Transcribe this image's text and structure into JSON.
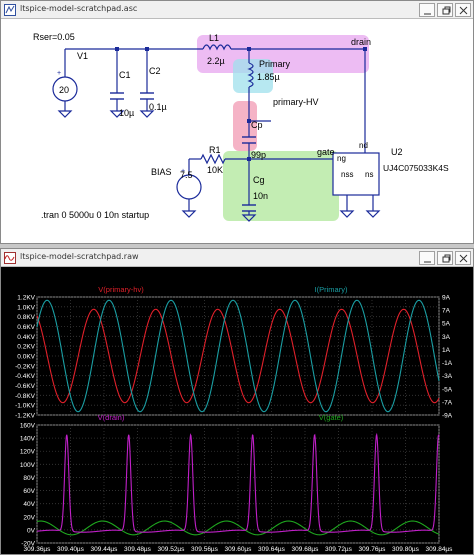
{
  "schematic_window": {
    "title": "ltspice-model-scratchpad.asc",
    "buttons": [
      "minimize",
      "restore",
      "close"
    ],
    "labels": {
      "rser": "Rser=0.05",
      "v1_name": "V1",
      "v1_value": "20",
      "c1_name": "C1",
      "c1_value": "10µ",
      "c2_name": "C2",
      "c2_value": "0.1µ",
      "l1_name": "L1",
      "l1_value": "2.2µ",
      "drain_net": "drain",
      "primary_name": "Primary",
      "primary_value": "1.85µ",
      "primary_hv_net": "primary-HV",
      "cp_name": "Cp",
      "cp_value": "99p",
      "r1_name": "R1",
      "r1_value": "10K",
      "bias_net": "BIAS",
      "bias_value": "7.5",
      "gate_net": "gate",
      "cg_name": "Cg",
      "cg_value": "10n",
      "u2_name": "U2",
      "u2_part": "UJ4C075033K4S",
      "pin_nd": "nd",
      "pin_ng": "ng",
      "pin_nss": "nss",
      "pin_ns": "ns",
      "directive": ".tran 0 5000u 0 10n startup"
    }
  },
  "waveform_window": {
    "title": "ltspice-model-scratchpad.raw",
    "buttons": [
      "minimize",
      "restore",
      "close"
    ]
  },
  "chart_data": [
    {
      "type": "line",
      "pane": "top",
      "series": [
        {
          "name": "V(primary-hv)",
          "color": "#e0202a",
          "axis": "left",
          "unit": "KV",
          "amplitude": 0.95,
          "shape": "sine"
        },
        {
          "name": "I(Primary)",
          "color": "#1a9ea3",
          "axis": "right",
          "unit": "A",
          "amplitude": 8.5,
          "shape": "sine"
        }
      ],
      "y_left_ticks": [
        "1.2KV",
        "1.0KV",
        "0.8KV",
        "0.6KV",
        "0.4KV",
        "0.2KV",
        "0.0KV",
        "-0.2KV",
        "-0.4KV",
        "-0.6KV",
        "-0.8KV",
        "-1.0KV",
        "-1.2KV"
      ],
      "y_right_ticks": [
        "9A",
        "7A",
        "5A",
        "3A",
        "1A",
        "-1A",
        "-3A",
        "-5A",
        "-7A",
        "-9A"
      ],
      "ylim_left": [
        -1.2,
        1.2
      ],
      "ylim_right": [
        -9,
        9
      ],
      "grid": true
    },
    {
      "type": "line",
      "pane": "bottom",
      "series": [
        {
          "name": "V(drain)",
          "color": "#c020c8",
          "axis": "left",
          "unit": "V",
          "peak": 147,
          "shape": "pulse"
        },
        {
          "name": "V(gate)",
          "color": "#1fa81f",
          "axis": "left",
          "unit": "V",
          "amplitude": 15,
          "shape": "sine"
        }
      ],
      "y_ticks": [
        "160V",
        "140V",
        "120V",
        "100V",
        "80V",
        "60V",
        "40V",
        "20V",
        "0V",
        "-20V"
      ],
      "ylim": [
        -20,
        160
      ],
      "grid": true
    }
  ],
  "x_axis": {
    "ticks": [
      "309.36µs",
      "309.40µs",
      "309.44µs",
      "309.48µs",
      "309.52µs",
      "309.56µs",
      "309.60µs",
      "309.64µs",
      "309.68µs",
      "309.72µs",
      "309.76µs",
      "309.80µs",
      "309.84µs"
    ],
    "xlim": [
      309.36,
      309.84
    ],
    "unit": "µs",
    "period": 0.074
  }
}
